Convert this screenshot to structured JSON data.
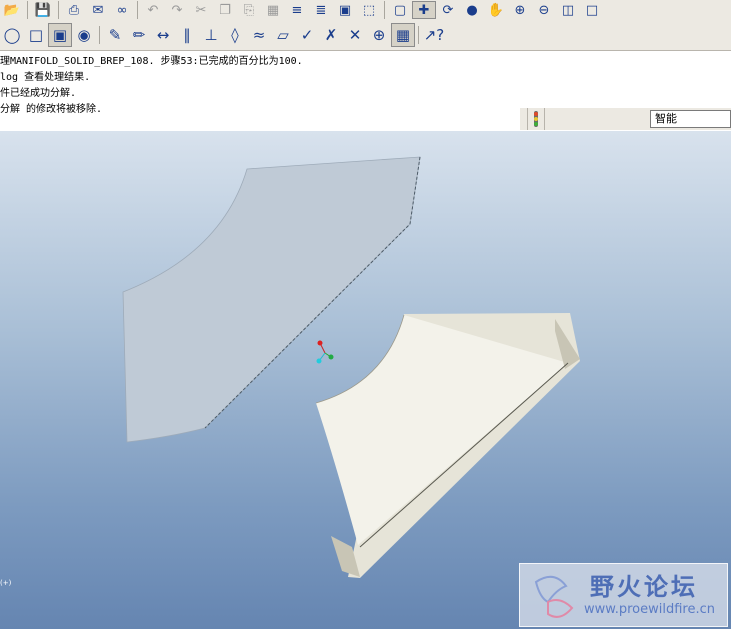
{
  "messages": [
    "理MANIFOLD_SOLID_BREP_108. 步骤53:已完成的百分比为100.",
    "log 查看处理结果.",
    "件已经成功分解.",
    "分解 的修改将被移除."
  ],
  "filter": {
    "selected": "智能"
  },
  "viewport": {
    "label": "(+)"
  },
  "watermark": {
    "title": "野火论坛",
    "url": "www.proewildfire.cn"
  },
  "colors": {
    "toolbar_bg": "#ece9e2",
    "background_top": "#d8e2ed",
    "background_bottom": "#6585b1",
    "surface_part": "#bfcad6",
    "solid_part": "#f3f2ea"
  },
  "toolbar_row1_icons": [
    "open-icon",
    "save-icon",
    "print-icon",
    "send-icon",
    "link-icon",
    "undo-icon",
    "redo-icon",
    "cut-icon",
    "copy-icon",
    "paste-icon",
    "paste-special-icon",
    "regenerate-icon",
    "regenerate-manager-icon",
    "find-icon",
    "select-box-icon",
    "repaint-icon",
    "spin-center-icon",
    "orient-icon",
    "shading-icon",
    "pan-icon",
    "zoom-in-icon",
    "zoom-out-icon",
    "refit-icon",
    "view-icon"
  ],
  "toolbar_row2_icons": [
    "hidden-line-icon",
    "no-hidden-icon",
    "shading-display-icon",
    "enhanced-realism-icon",
    "spec-tree-icon",
    "edit-definition-icon",
    "dimension-icon",
    "reference-dim-icon",
    "baseline-icon",
    "datum-plane-icon",
    "datum-axis-icon",
    "datum-curve-icon",
    "datum-plane-display-icon",
    "axis-display-icon",
    "point-display-icon",
    "csys-display-icon",
    "annotation-display-icon",
    "context-help-icon"
  ]
}
